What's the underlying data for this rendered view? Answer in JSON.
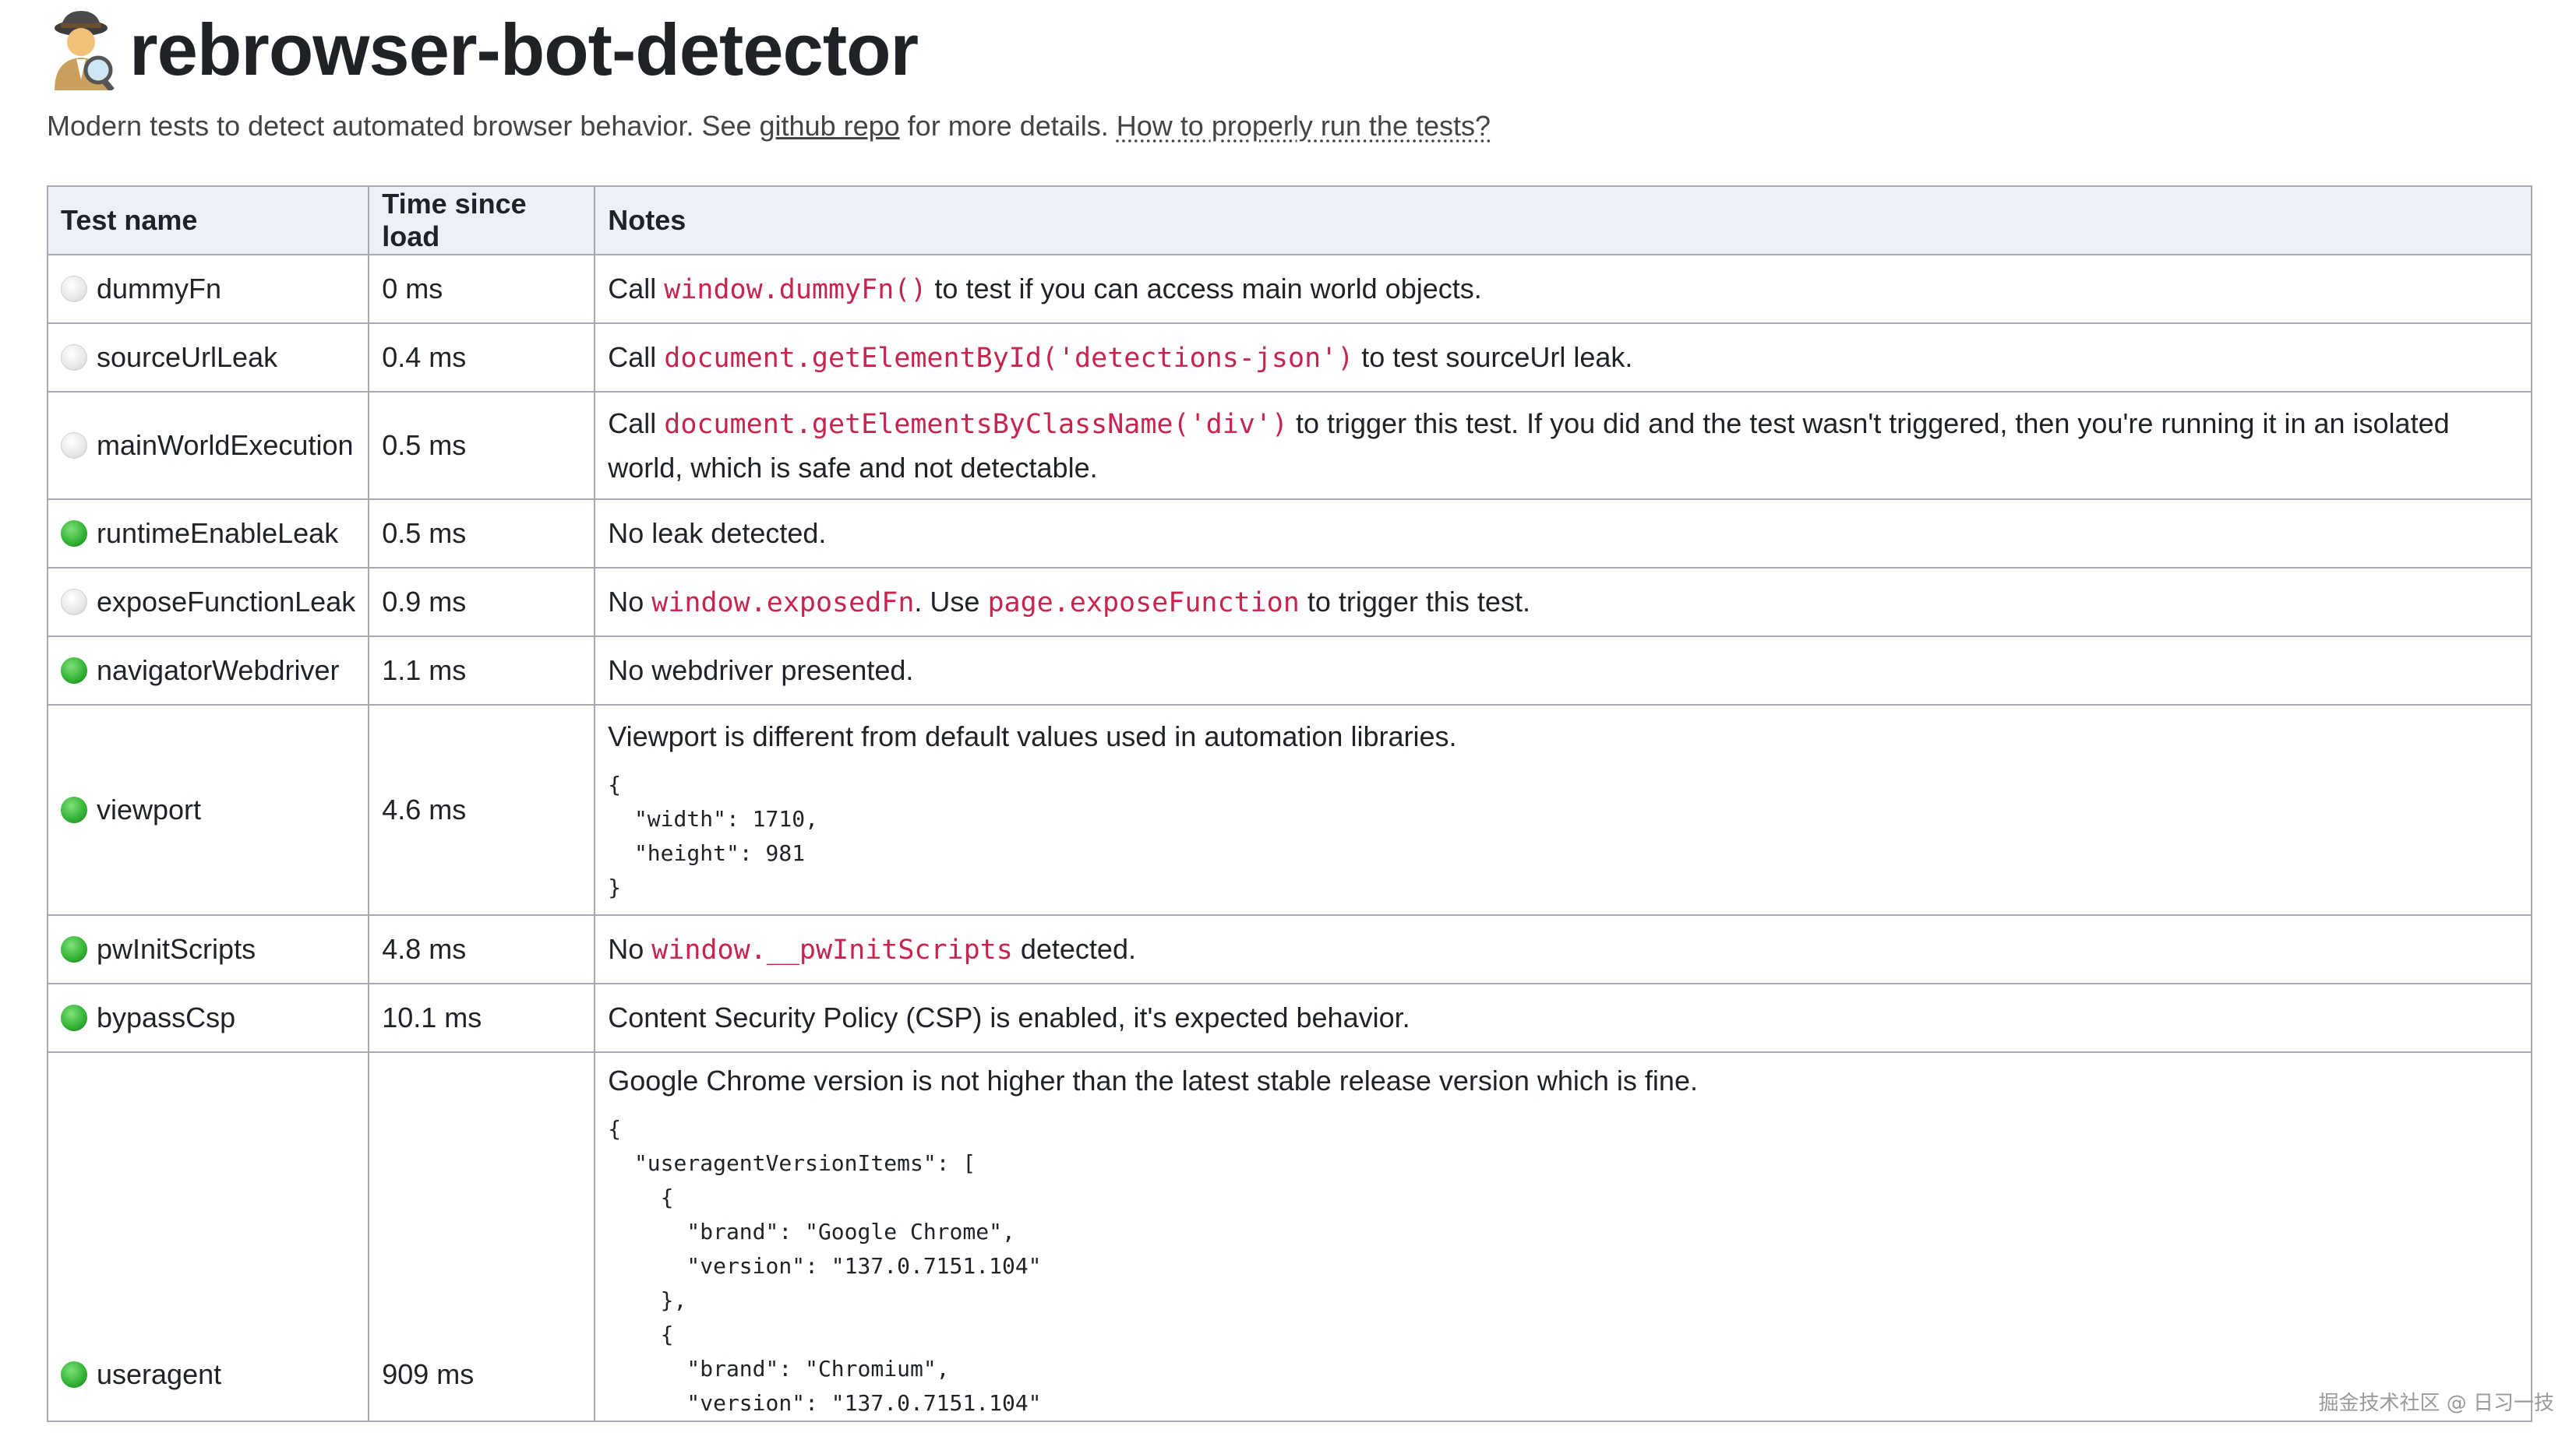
{
  "header": {
    "title": "rebrowser-bot-detector",
    "subtitle_prefix": "Modern tests to detect automated browser behavior. See ",
    "github_link": "github repo",
    "subtitle_middle": " for more details. ",
    "howto_link": "How to properly run the tests?"
  },
  "table": {
    "columns": [
      "Test name",
      "Time since load",
      "Notes"
    ],
    "rows": [
      {
        "status": "grey",
        "name": "dummyFn",
        "time": "0 ms",
        "note": {
          "pre": "Call ",
          "code": "window.dummyFn()",
          "post": " to test if you can access main world objects."
        }
      },
      {
        "status": "grey",
        "name": "sourceUrlLeak",
        "time": "0.4 ms",
        "note": {
          "pre": "Call ",
          "code": "document.getElementById('detections-json')",
          "post": " to test sourceUrl leak."
        }
      },
      {
        "status": "grey",
        "name": "mainWorldExecution",
        "time": "0.5 ms",
        "note": {
          "pre": "Call ",
          "code": "document.getElementsByClassName('div')",
          "post": " to trigger this test. If you did and the test wasn't triggered, then you're running it in an isolated world, which is safe and not detectable."
        }
      },
      {
        "status": "green",
        "name": "runtimeEnableLeak",
        "time": "0.5 ms",
        "note": {
          "text": "No leak detected."
        }
      },
      {
        "status": "grey",
        "name": "exposeFunctionLeak",
        "time": "0.9 ms",
        "note": {
          "pre": "No ",
          "code": "window.exposedFn",
          "mid": ". Use ",
          "code2": "page.exposeFunction",
          "post": " to trigger this test."
        }
      },
      {
        "status": "green",
        "name": "navigatorWebdriver",
        "time": "1.1 ms",
        "note": {
          "text": "No webdriver presented."
        }
      },
      {
        "status": "green",
        "name": "viewport",
        "time": "4.6 ms",
        "note": {
          "text": "Viewport is different from default values used in automation libraries.",
          "json": "{\n  \"width\": 1710,\n  \"height\": 981\n}"
        }
      },
      {
        "status": "green",
        "name": "pwInitScripts",
        "time": "4.8 ms",
        "note": {
          "pre": "No ",
          "code": "window.__pwInitScripts",
          "post": " detected."
        }
      },
      {
        "status": "green",
        "name": "bypassCsp",
        "time": "10.1 ms",
        "note": {
          "text": "Content Security Policy (CSP) is enabled, it's expected behavior."
        }
      },
      {
        "status": "green",
        "name": "useragent",
        "time": "909 ms",
        "note": {
          "text": "Google Chrome version is not higher than the latest stable release version which is fine.",
          "json": "{\n  \"useragentVersionItems\": [\n    {\n      \"brand\": \"Google Chrome\",\n      \"version\": \"137.0.7151.104\"\n    },\n    {\n      \"brand\": \"Chromium\",\n      \"version\": \"137.0.7151.104\""
        }
      }
    ]
  },
  "watermark": "掘金技术社区 @ 日习一技",
  "colors": {
    "code": "#c7254e",
    "header_bg": "#eef0f8",
    "border": "#a9a9b2",
    "green": "#35b535",
    "grey": "#e8e8ea"
  }
}
